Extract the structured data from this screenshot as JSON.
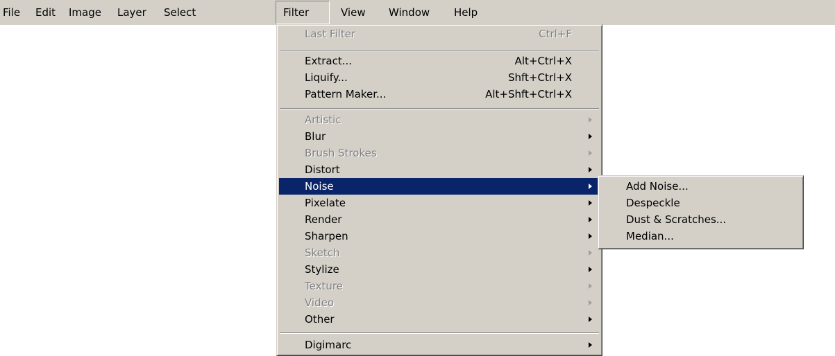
{
  "menubar": {
    "items": [
      {
        "label": "File"
      },
      {
        "label": "Edit"
      },
      {
        "label": "Image"
      },
      {
        "label": "Layer"
      },
      {
        "label": "Select"
      },
      {
        "label": "Filter"
      },
      {
        "label": "View"
      },
      {
        "label": "Window"
      },
      {
        "label": "Help"
      }
    ],
    "active": "Filter"
  },
  "filter_menu": {
    "last_filter": {
      "label": "Last Filter",
      "shortcut": "Ctrl+F",
      "enabled": false
    },
    "extract": {
      "label": "Extract...",
      "shortcut": "Alt+Ctrl+X"
    },
    "liquify": {
      "label": "Liquify...",
      "shortcut": "Shft+Ctrl+X"
    },
    "pattern_maker": {
      "label": "Pattern Maker...",
      "shortcut": "Alt+Shft+Ctrl+X"
    },
    "submenus": [
      {
        "label": "Artistic",
        "enabled": false
      },
      {
        "label": "Blur",
        "enabled": true
      },
      {
        "label": "Brush Strokes",
        "enabled": false
      },
      {
        "label": "Distort",
        "enabled": true
      },
      {
        "label": "Noise",
        "enabled": true,
        "highlighted": true
      },
      {
        "label": "Pixelate",
        "enabled": true
      },
      {
        "label": "Render",
        "enabled": true
      },
      {
        "label": "Sharpen",
        "enabled": true
      },
      {
        "label": "Sketch",
        "enabled": false
      },
      {
        "label": "Stylize",
        "enabled": true
      },
      {
        "label": "Texture",
        "enabled": false
      },
      {
        "label": "Video",
        "enabled": false
      },
      {
        "label": "Other",
        "enabled": true
      }
    ],
    "digimarc": {
      "label": "Digimarc"
    }
  },
  "noise_submenu": {
    "items": [
      {
        "label": "Add Noise..."
      },
      {
        "label": "Despeckle"
      },
      {
        "label": "Dust & Scratches..."
      },
      {
        "label": "Median..."
      }
    ]
  },
  "colors": {
    "menu_face": "#d4d0c8",
    "highlight": "#0a246a",
    "disabled_text": "#808080"
  }
}
